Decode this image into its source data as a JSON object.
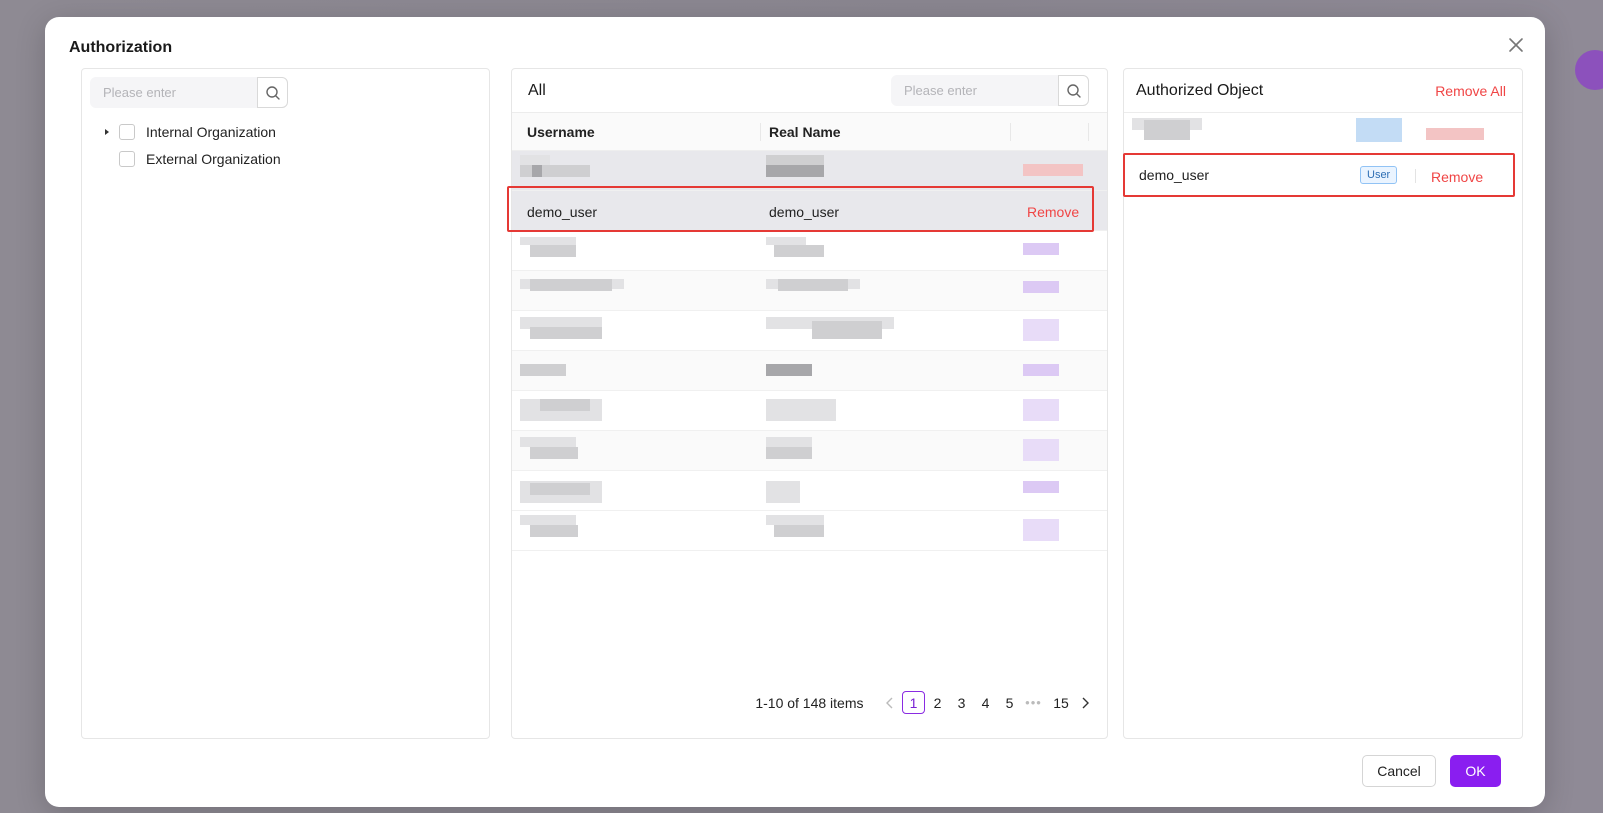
{
  "dialog": {
    "title": "Authorization",
    "cancel_label": "Cancel",
    "ok_label": "OK"
  },
  "left_panel": {
    "search": {
      "placeholder": "Please enter",
      "value": ""
    },
    "tree": [
      {
        "label": "Internal Organization",
        "expandable": true
      },
      {
        "label": "External Organization",
        "expandable": false
      }
    ]
  },
  "middle_panel": {
    "title": "All",
    "search": {
      "placeholder": "Please enter",
      "value": ""
    },
    "columns": [
      "Username",
      "Real Name"
    ],
    "selected_row": {
      "username": "demo_user",
      "real_name": "demo_user",
      "action": "Remove"
    },
    "pagination": {
      "total_text": "1-10 of 148 items",
      "pages": [
        "1",
        "2",
        "3",
        "4",
        "5"
      ],
      "current": "1",
      "ellipsis": "•••",
      "last": "15"
    }
  },
  "right_panel": {
    "title": "Authorized Object",
    "remove_all_label": "Remove All",
    "items": [
      {
        "name": "demo_user",
        "tag": "User",
        "action": "Remove"
      }
    ]
  },
  "colors": {
    "primary": "#8a1ef0",
    "danger": "#f04545",
    "highlight": "#e53935",
    "tag_blue": "#2f6fb4"
  }
}
